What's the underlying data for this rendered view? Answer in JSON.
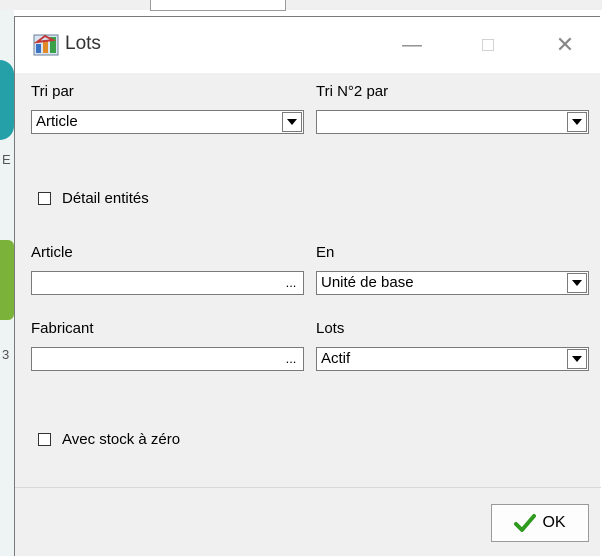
{
  "dialog": {
    "title": "Lots",
    "window_controls": {
      "minimize": "—",
      "maximize": "□",
      "close": "✕"
    }
  },
  "sort": {
    "primary_label": "Tri par",
    "primary_value": "Article",
    "secondary_label": "Tri N°2 par",
    "secondary_value": ""
  },
  "detail_entities": {
    "label": "Détail entités",
    "checked": false
  },
  "article": {
    "label": "Article",
    "value": "",
    "browse": "..."
  },
  "unit": {
    "label": "En",
    "value": "Unité de base"
  },
  "manufacturer": {
    "label": "Fabricant",
    "value": "",
    "browse": "..."
  },
  "lots": {
    "label": "Lots",
    "value": "Actif"
  },
  "zero_stock": {
    "label": "Avec stock à zéro",
    "checked": false
  },
  "ok_button": {
    "label": "OK",
    "icon": "green-checkmark-icon"
  },
  "colors": {
    "accent_check": "#2e9a1e",
    "dialog_bg": "#f0f0f0"
  }
}
